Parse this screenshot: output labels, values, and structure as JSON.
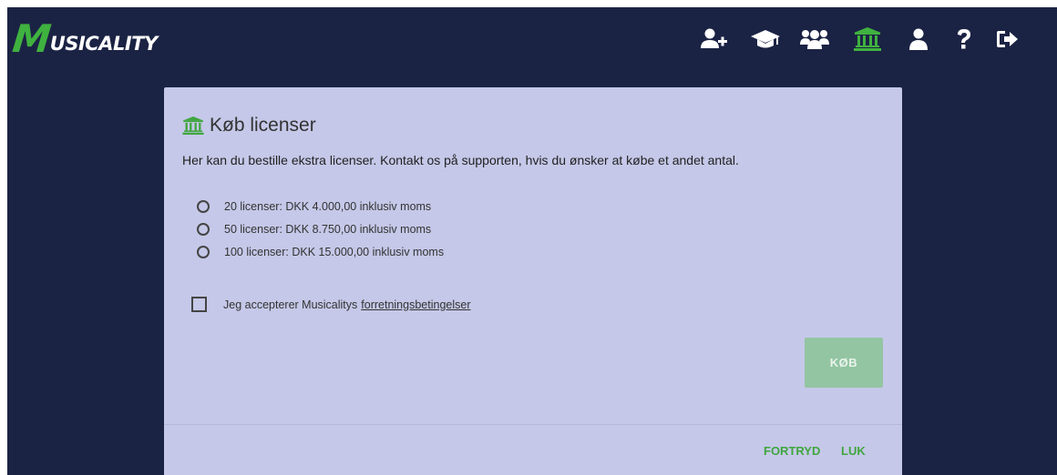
{
  "app": {
    "logo_letter": "M",
    "logo_text": "USICALITY"
  },
  "nav": {
    "icons": [
      "add-user-icon",
      "graduation-cap-icon",
      "users-icon",
      "bank-icon",
      "user-icon",
      "question-icon",
      "logout-icon"
    ],
    "active": "bank-icon",
    "accent": "#3fb23f"
  },
  "dialog": {
    "title": "Køb licenser",
    "description": "Her kan du bestille ekstra licenser. Kontakt os på supporten, hvis du ønsker at købe et andet antal.",
    "options": [
      {
        "label": "20 licenser: DKK 4.000,00 inklusiv moms",
        "selected": false
      },
      {
        "label": "50 licenser: DKK 8.750,00 inklusiv moms",
        "selected": false
      },
      {
        "label": "100 licenser: DKK 15.000,00 inklusiv moms",
        "selected": false
      }
    ],
    "accept_text": "Jeg accepterer Musicalitys",
    "accept_link": "forretningsbetingelser",
    "accept_checked": false,
    "buy_label": "KØB",
    "cancel_label": "FORTRYD",
    "close_label": "LUK"
  },
  "colors": {
    "background": "#1b2344",
    "dialog": "#c5c8e8",
    "accent_green": "#3fa63f",
    "buy_disabled": "#93c5a2"
  }
}
